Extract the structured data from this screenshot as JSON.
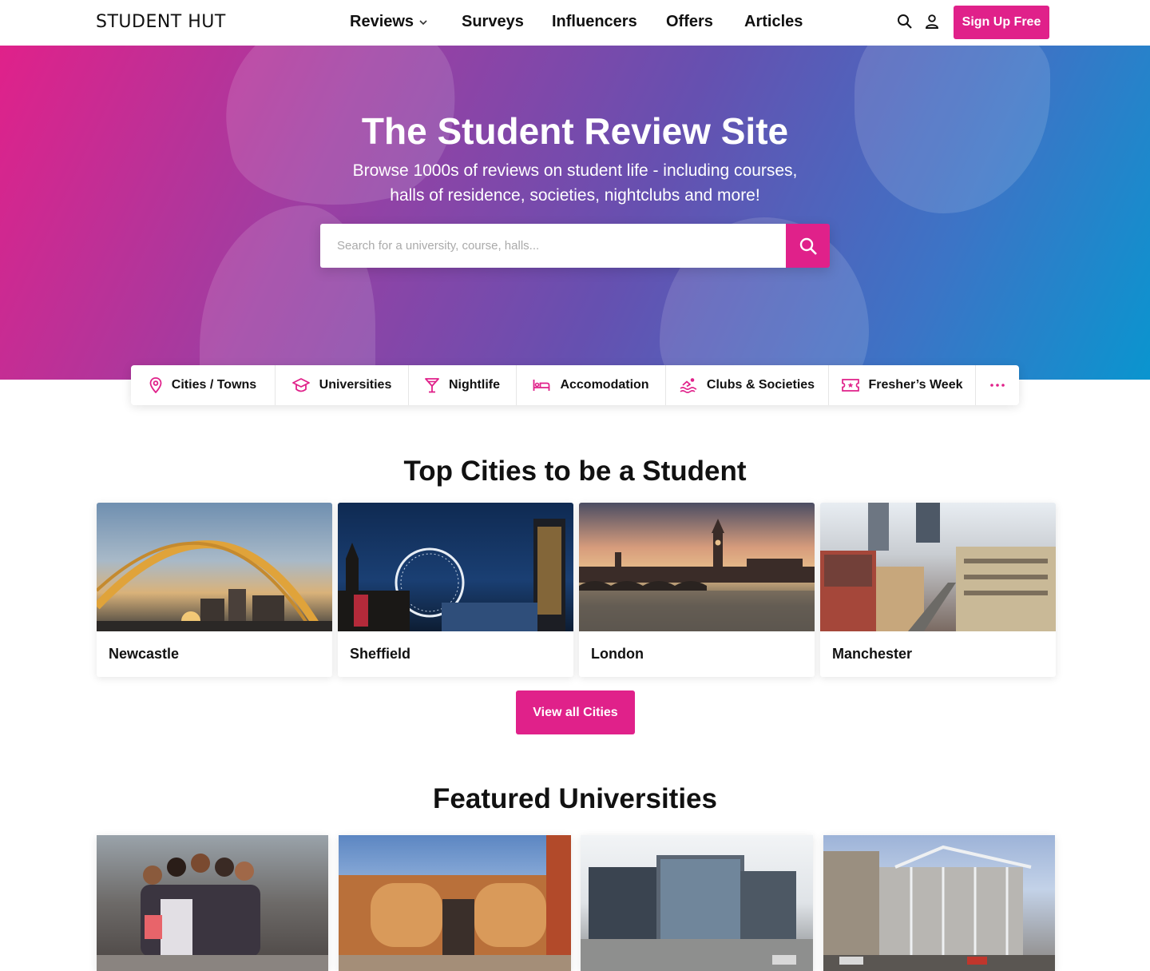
{
  "header": {
    "logo": "STUDENT HUT",
    "nav": {
      "reviews": "Reviews",
      "surveys": "Surveys",
      "influencers": "Influencers",
      "offers": "Offers",
      "articles": "Articles"
    },
    "signup_label": "Sign Up Free"
  },
  "hero": {
    "title": "The Student Review Site",
    "subtitle_line1": "Browse 1000s of reviews on student life - including courses,",
    "subtitle_line2": "halls of residence, societies, nightclubs and more!",
    "search_placeholder": "Search for a university, course, halls..."
  },
  "categories": [
    {
      "label": "Cities / Towns",
      "icon": "map-pin-icon"
    },
    {
      "label": "Universities",
      "icon": "graduation-cap-icon"
    },
    {
      "label": "Nightlife",
      "icon": "cocktail-icon"
    },
    {
      "label": "Accomodation",
      "icon": "bed-icon"
    },
    {
      "label": "Clubs & Societies",
      "icon": "swimmer-icon"
    },
    {
      "label": "Fresher’s Week",
      "icon": "ticket-icon"
    },
    {
      "label": "",
      "icon": "more-dots-icon"
    }
  ],
  "cities": {
    "title": "Top Cities to be a Student",
    "items": [
      "Newcastle",
      "Sheffield",
      "London",
      "Manchester"
    ],
    "view_all_label": "View all Cities"
  },
  "universities": {
    "title": "Featured Universities"
  },
  "colors": {
    "accent": "#e0218a",
    "gradient_start": "#e0218a",
    "gradient_end": "#0a95cf"
  }
}
